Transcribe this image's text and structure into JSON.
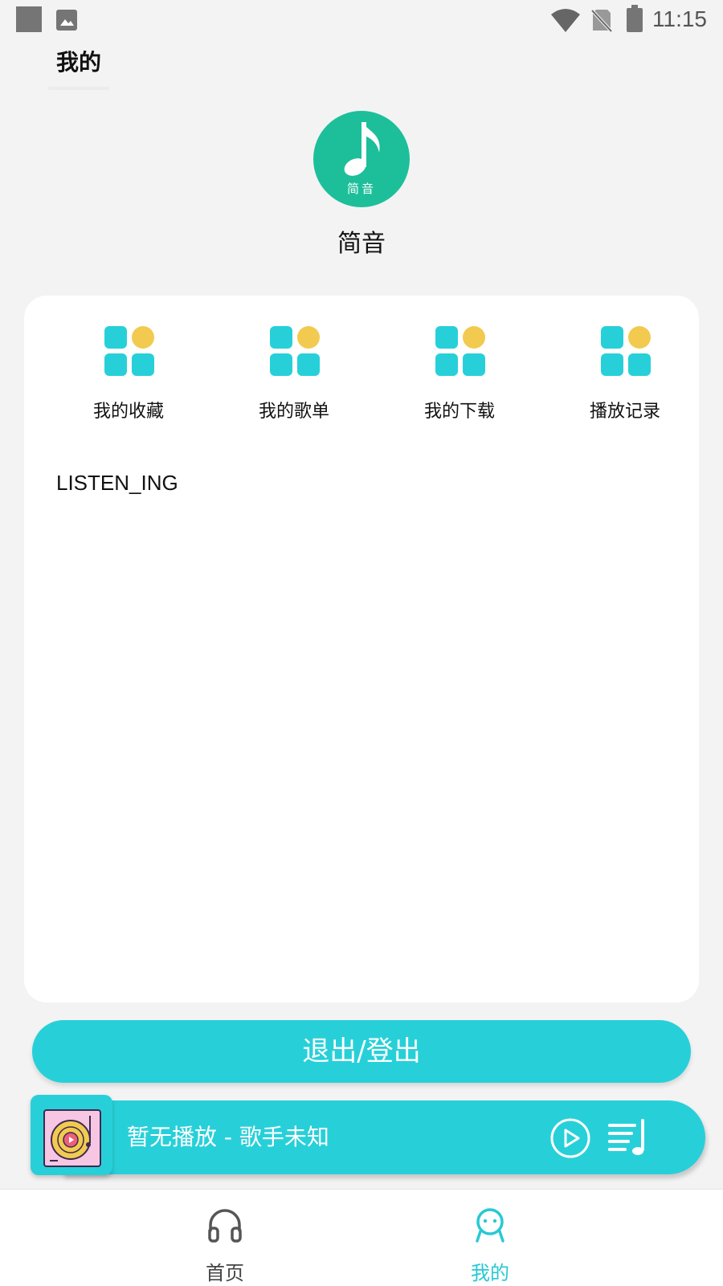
{
  "status_bar": {
    "time": "11:15"
  },
  "header": {
    "title": "我的"
  },
  "profile": {
    "avatar_text": "简音",
    "name": "简音"
  },
  "menu": {
    "items": [
      {
        "label": "我的收藏",
        "icon": "grid-icon"
      },
      {
        "label": "我的歌单",
        "icon": "grid-icon"
      },
      {
        "label": "我的下载",
        "icon": "grid-icon"
      },
      {
        "label": "播放记录",
        "icon": "grid-icon"
      }
    ]
  },
  "listening": {
    "label": "LISTEN_ING"
  },
  "logout": {
    "label": "退出/登出"
  },
  "player": {
    "now_playing": "暂无播放 - 歌手未知"
  },
  "bottom_nav": {
    "items": [
      {
        "label": "首页",
        "icon": "headphones-icon",
        "active": false
      },
      {
        "label": "我的",
        "icon": "smiley-user-icon",
        "active": true
      }
    ]
  },
  "colors": {
    "accent": "#27d0d9",
    "avatar_bg": "#1dbf9a",
    "icon_dot": "#f2ca4f",
    "background": "#f3f3f3"
  }
}
